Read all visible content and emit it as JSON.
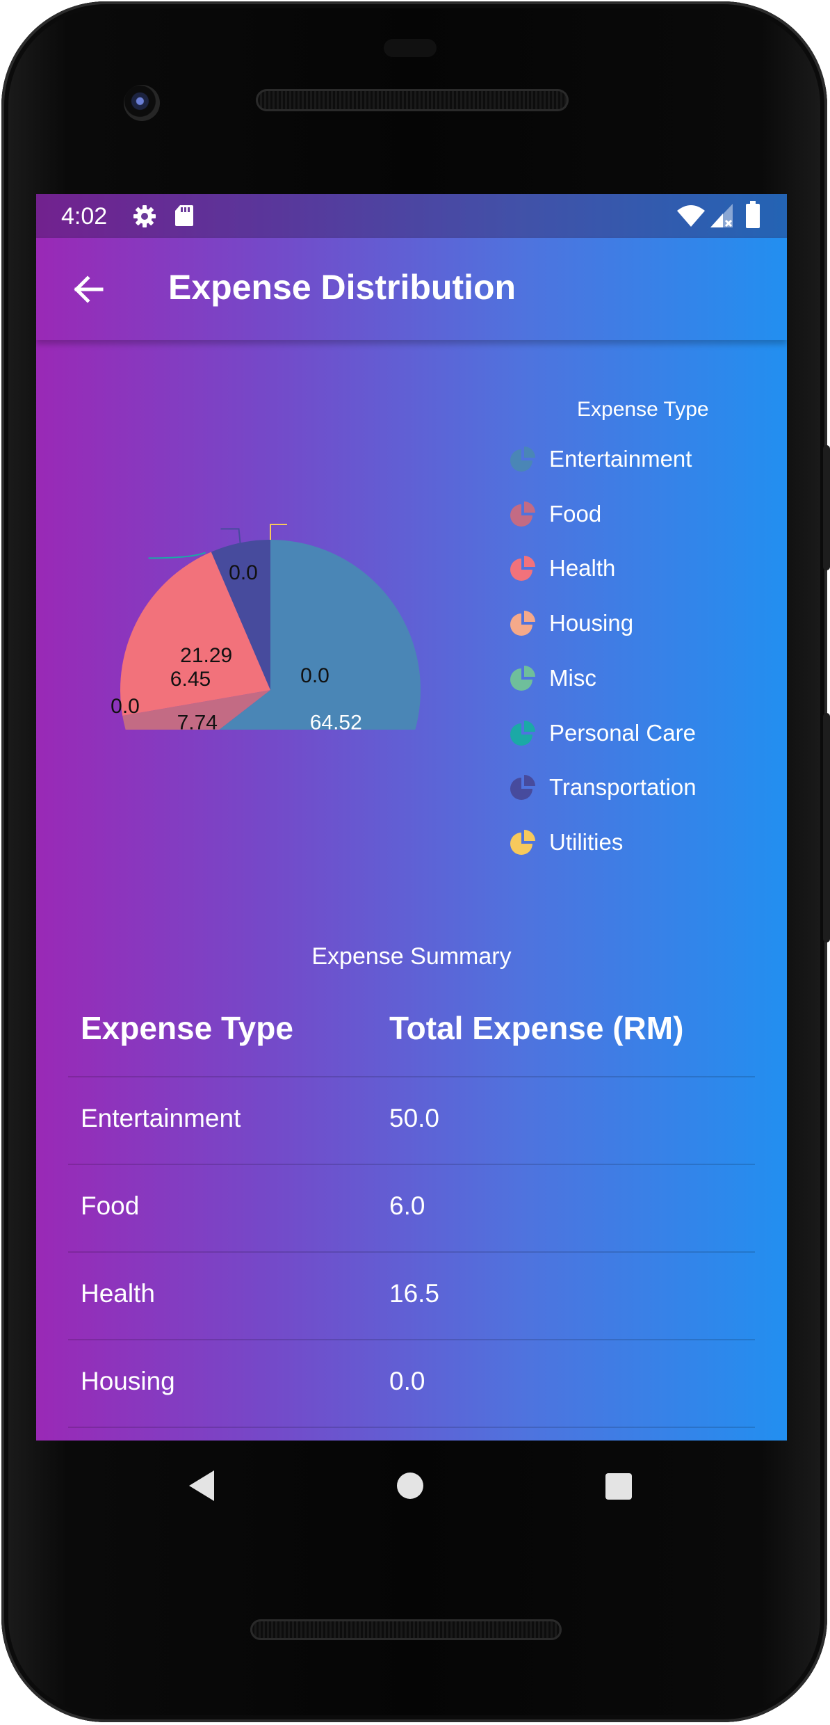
{
  "status_bar": {
    "time": "4:02",
    "icons": [
      "gear-icon",
      "sd-card-icon",
      "wifi-icon",
      "signal-icon",
      "battery-icon"
    ]
  },
  "app_bar": {
    "title": "Expense Distribution",
    "back_icon": "arrow-left-icon"
  },
  "legend": {
    "title": "Expense Type",
    "items": [
      {
        "label": "Entertainment",
        "color": "#4a86b6"
      },
      {
        "label": "Food",
        "color": "#c36b84"
      },
      {
        "label": "Health",
        "color": "#f2727b"
      },
      {
        "label": "Housing",
        "color": "#f5a98a"
      },
      {
        "label": "Misc",
        "color": "#6fbf9b"
      },
      {
        "label": "Personal Care",
        "color": "#1ba9a6"
      },
      {
        "label": "Transportation",
        "color": "#474b9d"
      },
      {
        "label": "Utilities",
        "color": "#f7c95c"
      }
    ]
  },
  "chart_data": {
    "type": "pie",
    "title": "",
    "categories": [
      "Entertainment",
      "Food",
      "Health",
      "Housing",
      "Misc",
      "Personal Care",
      "Transportation",
      "Utilities"
    ],
    "values": [
      64.52,
      7.74,
      21.29,
      0.0,
      0.0,
      0.0,
      6.45,
      0.0
    ],
    "legend_title": "Expense Type",
    "legend_position": "right"
  },
  "summary": {
    "title": "Expense Summary",
    "columns": [
      "Expense Type",
      "Total Expense (RM)"
    ],
    "rows": [
      [
        "Entertainment",
        "50.0"
      ],
      [
        "Food",
        "6.0"
      ],
      [
        "Health",
        "16.5"
      ],
      [
        "Housing",
        "0.0"
      ]
    ]
  },
  "nav_bar": {
    "buttons": [
      "back-triangle-icon",
      "home-circle-icon",
      "recents-square-icon"
    ]
  }
}
